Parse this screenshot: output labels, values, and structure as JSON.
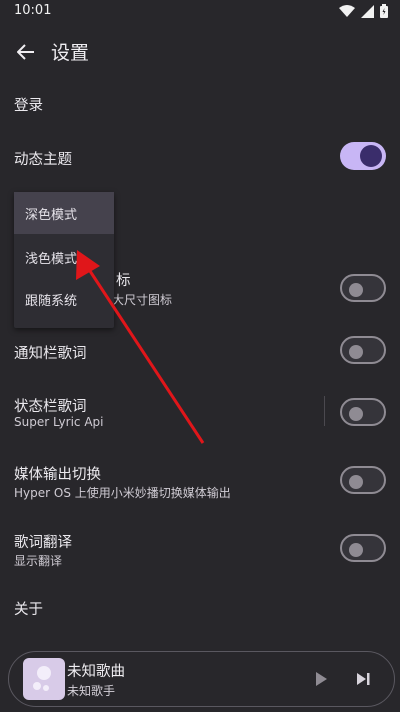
{
  "status_bar": {
    "time": "10:01",
    "icons": [
      "wifi-icon",
      "cell-signal-icon",
      "battery-icon"
    ]
  },
  "app_bar": {
    "title": "设置",
    "back_icon": "arrow-left-icon"
  },
  "settings": {
    "login": {
      "title": "登录"
    },
    "dynamic_theme": {
      "title": "动态主题",
      "enabled": true
    },
    "hidden_row": {
      "title_tail": "标",
      "subtitle_tail": "大尺寸图标",
      "enabled": false
    },
    "notification_lyrics": {
      "title": "通知栏歌词",
      "enabled": false
    },
    "statusbar_lyrics": {
      "title": "状态栏歌词",
      "subtitle": "Super Lyric Api",
      "enabled": false
    },
    "media_output": {
      "title": "媒体输出切换",
      "subtitle": "Hyper OS 上使用小米妙播切换媒体输出",
      "enabled": false
    },
    "lyrics_translation": {
      "title": "歌词翻译",
      "subtitle": "显示翻译",
      "enabled": false
    },
    "about": {
      "title": "关于"
    }
  },
  "theme_menu": {
    "items": [
      "深色模式",
      "浅色模式",
      "跟随系统"
    ],
    "selected": "深色模式"
  },
  "mini_player": {
    "title": "未知歌曲",
    "artist": "未知歌手",
    "play_icon": "play-icon",
    "next_icon": "skip-next-icon"
  },
  "colors": {
    "background": "#28272b",
    "switch_on_track": "#c8b6f5",
    "switch_on_knob": "#3a2d6b",
    "annotation_arrow": "#e0161a"
  }
}
